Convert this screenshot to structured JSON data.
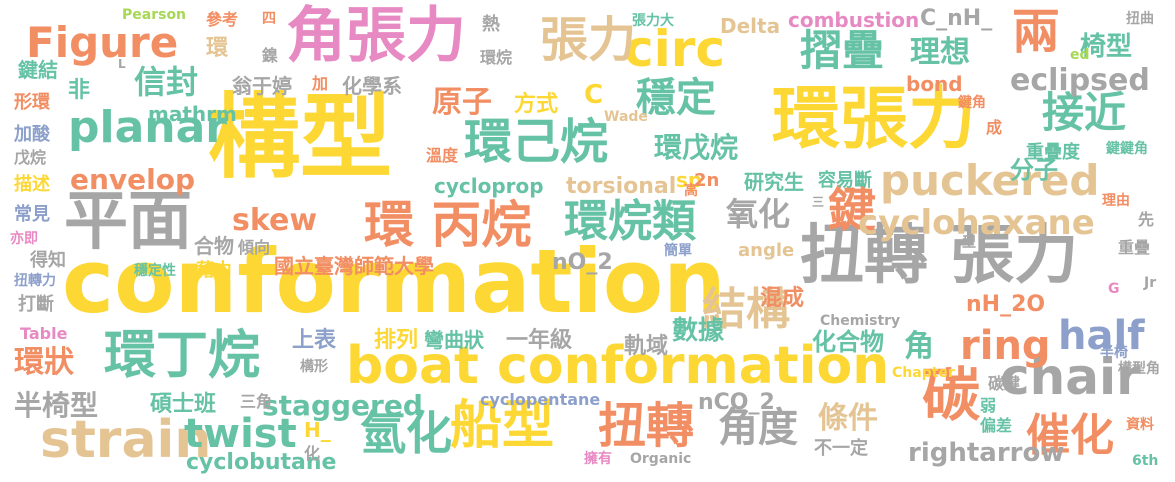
{
  "colors": {
    "yellow": "#FDD835",
    "gray": "#A6A6A6",
    "orange": "#F28E63",
    "green": "#66C2A5",
    "pink": "#E78AC3",
    "tan": "#E5C494",
    "blue": "#8DA0CB",
    "lime": "#A6D854"
  },
  "words": [
    {
      "text": "構型",
      "color": "yellow"
    },
    {
      "text": "conformation",
      "color": "yellow"
    },
    {
      "text": "環張力",
      "color": "yellow"
    },
    {
      "text": "扭轉 張力",
      "color": "gray"
    },
    {
      "text": "角張力",
      "color": "pink"
    },
    {
      "text": "boat conformation",
      "color": "yellow"
    },
    {
      "text": "平面",
      "color": "gray"
    },
    {
      "text": "circ",
      "color": "yellow"
    },
    {
      "text": "張力",
      "color": "tan"
    },
    {
      "text": "摺疊",
      "color": "green"
    },
    {
      "text": "兩",
      "color": "orange"
    },
    {
      "text": "Figure",
      "color": "orange"
    },
    {
      "text": "環己烷",
      "color": "green"
    },
    {
      "text": "planar",
      "color": "green"
    },
    {
      "text": "環 丙烷",
      "color": "orange"
    },
    {
      "text": "環丁烷",
      "color": "green"
    },
    {
      "text": "strain",
      "color": "tan"
    },
    {
      "text": "chair",
      "color": "gray"
    },
    {
      "text": "碳",
      "color": "orange"
    },
    {
      "text": "鍵",
      "color": "orange"
    },
    {
      "text": "環烷類",
      "color": "green"
    },
    {
      "text": "puckered",
      "color": "tan"
    },
    {
      "text": "結構",
      "color": "tan"
    },
    {
      "text": "扭轉",
      "color": "orange"
    },
    {
      "text": "船型",
      "color": "yellow"
    },
    {
      "text": "氫化",
      "color": "green"
    },
    {
      "text": "ring",
      "color": "orange"
    },
    {
      "text": "half",
      "color": "blue"
    },
    {
      "text": "催化",
      "color": "orange"
    },
    {
      "text": "角度",
      "color": "gray"
    },
    {
      "text": "twist",
      "color": "green"
    },
    {
      "text": "穩定",
      "color": "green"
    },
    {
      "text": "接近",
      "color": "green"
    },
    {
      "text": "eclipsed",
      "color": "gray"
    },
    {
      "text": "理想",
      "color": "green"
    },
    {
      "text": "椅型",
      "color": "green"
    },
    {
      "text": "信封",
      "color": "green"
    },
    {
      "text": "envelop",
      "color": "orange"
    },
    {
      "text": "cyclohaxane",
      "color": "tan"
    },
    {
      "text": "skew",
      "color": "orange"
    },
    {
      "text": "氧化",
      "color": "gray"
    },
    {
      "text": "原子",
      "color": "orange"
    },
    {
      "text": "環戊烷",
      "color": "green"
    },
    {
      "text": "staggered",
      "color": "green"
    },
    {
      "text": "環狀",
      "color": "orange"
    },
    {
      "text": "半椅型",
      "color": "gray"
    },
    {
      "text": "角",
      "color": "green"
    },
    {
      "text": "條件",
      "color": "tan"
    },
    {
      "text": "化合物",
      "color": "green"
    },
    {
      "text": "分子",
      "color": "green"
    },
    {
      "text": "國立臺灣師範大學",
      "color": "orange"
    },
    {
      "text": "數據",
      "color": "green"
    },
    {
      "text": "混成",
      "color": "orange"
    },
    {
      "text": "rightarrow",
      "color": "gray"
    },
    {
      "text": "nCO_2",
      "color": "gray"
    },
    {
      "text": "nO_2",
      "color": "gray"
    },
    {
      "text": "nH_2O",
      "color": "orange"
    },
    {
      "text": "cycloprop",
      "color": "green"
    },
    {
      "text": "torsional",
      "color": "tan"
    },
    {
      "text": "sp",
      "color": "yellow"
    },
    {
      "text": "2n",
      "color": "orange"
    },
    {
      "text": "研究生",
      "color": "green"
    },
    {
      "text": "容易斷",
      "color": "green"
    },
    {
      "text": "重疊度",
      "color": "green"
    },
    {
      "text": "cyclobutane",
      "color": "green"
    },
    {
      "text": "cyclopentane",
      "color": "blue"
    },
    {
      "text": "碩士班",
      "color": "green"
    },
    {
      "text": "一年級",
      "color": "gray"
    },
    {
      "text": "排列",
      "color": "yellow"
    },
    {
      "text": "彎曲狀",
      "color": "green"
    },
    {
      "text": "軌域",
      "color": "gray"
    },
    {
      "text": "上表",
      "color": "blue"
    },
    {
      "text": "mathrm",
      "color": "green"
    },
    {
      "text": "方式",
      "color": "yellow"
    },
    {
      "text": "C",
      "color": "yellow"
    },
    {
      "text": "combustion",
      "color": "pink"
    },
    {
      "text": "C_nH_",
      "color": "gray"
    },
    {
      "text": "Delta",
      "color": "tan"
    },
    {
      "text": "bond",
      "color": "orange"
    },
    {
      "text": "鍵結",
      "color": "green"
    },
    {
      "text": "形環",
      "color": "orange"
    },
    {
      "text": "加酸",
      "color": "blue"
    },
    {
      "text": "戊烷",
      "color": "gray"
    },
    {
      "text": "描述",
      "color": "yellow"
    },
    {
      "text": "常見",
      "color": "blue"
    },
    {
      "text": "亦即",
      "color": "pink"
    },
    {
      "text": "得知",
      "color": "gray"
    },
    {
      "text": "扭轉力",
      "color": "blue"
    },
    {
      "text": "打斷",
      "color": "gray"
    },
    {
      "text": "Table",
      "color": "pink"
    },
    {
      "text": "翁于婷",
      "color": "gray"
    },
    {
      "text": "化學系",
      "color": "gray"
    },
    {
      "text": "合物",
      "color": "gray"
    },
    {
      "text": "傾向",
      "color": "gray"
    },
    {
      "text": "藉由",
      "color": "yellow"
    },
    {
      "text": "穩定性",
      "color": "green"
    },
    {
      "text": "溫度",
      "color": "orange"
    },
    {
      "text": "高",
      "color": "orange"
    },
    {
      "text": "簡單",
      "color": "blue"
    },
    {
      "text": "angle",
      "color": "tan"
    },
    {
      "text": "非",
      "color": "green"
    },
    {
      "text": "環",
      "color": "tan"
    },
    {
      "text": "鎳",
      "color": "gray"
    },
    {
      "text": "四",
      "color": "orange"
    },
    {
      "text": "參考",
      "color": "orange"
    },
    {
      "text": "Pearson",
      "color": "lime"
    },
    {
      "text": "熱",
      "color": "gray"
    },
    {
      "text": "張力大",
      "color": "green"
    },
    {
      "text": "環烷",
      "color": "gray"
    },
    {
      "text": "加",
      "color": "orange"
    },
    {
      "text": "Wade",
      "color": "tan"
    },
    {
      "text": "鍵角",
      "color": "orange"
    },
    {
      "text": "ed",
      "color": "lime"
    },
    {
      "text": "扭曲",
      "color": "gray"
    },
    {
      "text": "成",
      "color": "orange"
    },
    {
      "text": "鍵鍵角",
      "color": "green"
    },
    {
      "text": "理由",
      "color": "orange"
    },
    {
      "text": "先",
      "color": "gray"
    },
    {
      "text": "重疊",
      "color": "gray"
    },
    {
      "text": "型",
      "color": "gray"
    },
    {
      "text": "Jr",
      "color": "gray"
    },
    {
      "text": "G",
      "color": "pink"
    },
    {
      "text": "半椅",
      "color": "blue"
    },
    {
      "text": "構型角",
      "color": "gray"
    },
    {
      "text": "Chapter",
      "color": "yellow"
    },
    {
      "text": "碳鍵",
      "color": "gray"
    },
    {
      "text": "弱",
      "color": "green"
    },
    {
      "text": "偏差",
      "color": "green"
    },
    {
      "text": "資料",
      "color": "orange"
    },
    {
      "text": "6th",
      "color": "green"
    },
    {
      "text": "Chemistry",
      "color": "gray"
    },
    {
      "text": "Organic",
      "color": "gray"
    },
    {
      "text": "擁有",
      "color": "pink"
    },
    {
      "text": "不一定",
      "color": "gray"
    },
    {
      "text": "H_",
      "color": "yellow"
    },
    {
      "text": "化",
      "color": "gray"
    },
    {
      "text": "三角",
      "color": "gray"
    },
    {
      "text": "構形",
      "color": "gray"
    },
    {
      "text": "三",
      "color": "gray"
    },
    {
      "text": "L",
      "color": "gray"
    }
  ]
}
